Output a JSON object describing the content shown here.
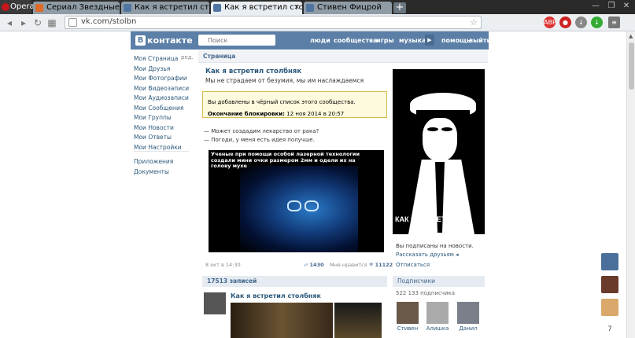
{
  "browser": {
    "app_name": "Opera",
    "tabs": [
      {
        "label": "Сериал Звездные врата:",
        "active": false
      },
      {
        "label": "Как я встретил столбняк",
        "active": false
      },
      {
        "label": "Как я встретил столбняк",
        "active": true
      },
      {
        "label": "Стивен Фицрой",
        "active": false
      }
    ],
    "url": "vk.com/stolbn",
    "extensions": [
      "adblock-icon",
      "stop-icon",
      "download-icon",
      "download-green-icon",
      "menu-icon"
    ]
  },
  "vk": {
    "logo_text": "контакте",
    "logo_letter": "В",
    "search_placeholder": "Поиск",
    "top_nav": [
      "люди",
      "сообщества",
      "игры",
      "музыка",
      "помощь",
      "выйти"
    ],
    "left_menu": [
      "Моя Страница",
      "Мои Друзья",
      "Мои Фотографии",
      "Мои Видеозаписи",
      "Мои Аудиозаписи",
      "Мои Сообщения",
      "Мои Группы",
      "Мои Новости",
      "Мои Ответы",
      "Мои Настройки"
    ],
    "left_menu_edit": "ред.",
    "left_menu_extra": [
      "Приложения",
      "Документы"
    ],
    "breadcrumb": "Страница",
    "group_title": "Как я встретил столбняк",
    "group_status": "Мы не страдаем от безумия, мы им наслаждаемся",
    "notice": {
      "line1": "Вы добавлены в чёрный список этого сообщества.",
      "end_label": "Окончание блокировки:",
      "end_value": "12 ноя 2014 в 20:57"
    },
    "post_lines": [
      "— Может создадим лекарство от рака?",
      "— Погоди, у меня есть идея получше."
    ],
    "post_image_caption": "Ученые при помощи особой лазерной технологии создали мини очки размером 2мм и одели их на голову мухе",
    "post_date": "8 окт в 14:30",
    "post_reposts": "1430",
    "post_like_label": "Мне нравится",
    "post_likes": "11122",
    "posts_count": "17513 записей",
    "post2_title": "Как я встретил столбняк",
    "cover_text_h": "КАК Я ВСТРЕТИЛ",
    "cover_text_v": "СТОЛБНЯК",
    "subscribed": "Вы подписаны на новости.",
    "tell_friends": "Рассказать друзьям",
    "unsubscribe": "Отписаться",
    "subscribers_header": "Подписчики",
    "subscribers_count": "522 133 подписчика",
    "members": [
      "Стивен",
      "Алишка",
      "Данил"
    ]
  }
}
